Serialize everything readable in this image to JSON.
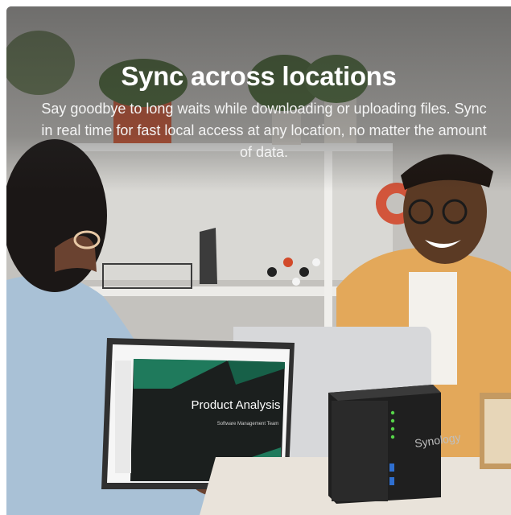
{
  "hero": {
    "title": "Sync across locations",
    "subtitle": "Say goodbye to long waits while downloading or uploading files. Sync in real time for fast local access at any location, no matter the amount of data."
  },
  "scene": {
    "slide_title": "Product Analysis",
    "slide_subtitle": "Software Management Team",
    "nas_brand": "Synology"
  },
  "colors": {
    "slide_green": "#1f7a5c",
    "slide_dark": "#1b1f1e",
    "shirt_yellow": "#e3a85a",
    "shirt_blue": "#a9c1d6",
    "nas_body": "#2a2a2a",
    "led_green": "#57d64a"
  }
}
